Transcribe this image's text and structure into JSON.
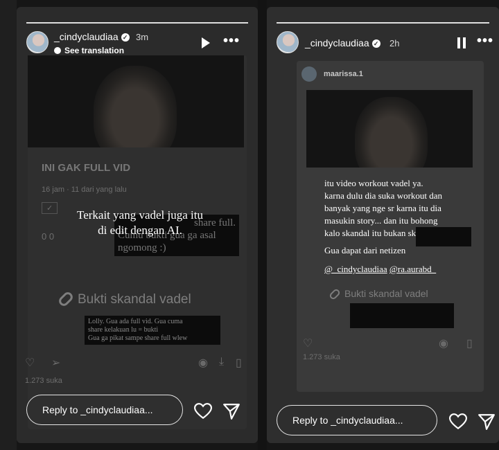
{
  "left_story": {
    "username": "_cindyclaudiaa",
    "time": "3m",
    "see_translation": "See translation",
    "post_title": "INI GAK FULL VID",
    "post_meta": "16 jam · 11 dari yang lalu",
    "post_counts": "0    0",
    "overlay_caption_line1": "Terkait yang vadel juga itu",
    "overlay_caption_line2": "di edit dengan AI.",
    "black_note_line1": "share full.",
    "black_note_line2": "Cumu bukti gua ga asal",
    "black_note_line3": "ngomong :)",
    "bukti": "Bukti skandal vadel",
    "bukti_note_line1": "Lolly. Gua ada full vid. Gua cuma",
    "bukti_note_line2": "share kelakuan lu = bukti",
    "bukti_note_line3": "Gua ga pikat sampe share full wlew",
    "likes": "1.273 suka",
    "reply_placeholder": "Reply to _cindyclaudiaa..."
  },
  "right_story": {
    "username": "_cindyclaudiaa",
    "time": "2h",
    "shared_username": "maarissa.1",
    "overlay_lines": [
      "itu video workout vadel ya.",
      "karna dulu dia suka workout dan",
      "banyak yang nge sr karna itu dia",
      "masukin story... dan itu bohong",
      "kalo skandal itu bukan skandal..."
    ],
    "from_netizen": "Gua dapat dari netizen",
    "mention1": "@_cindyclaudiaa",
    "mention2": "@ra.aurabd_",
    "bukti": "Bukti skandal vadel",
    "likes": "1.273 suka",
    "reply_placeholder": "Reply to _cindyclaudiaa..."
  }
}
